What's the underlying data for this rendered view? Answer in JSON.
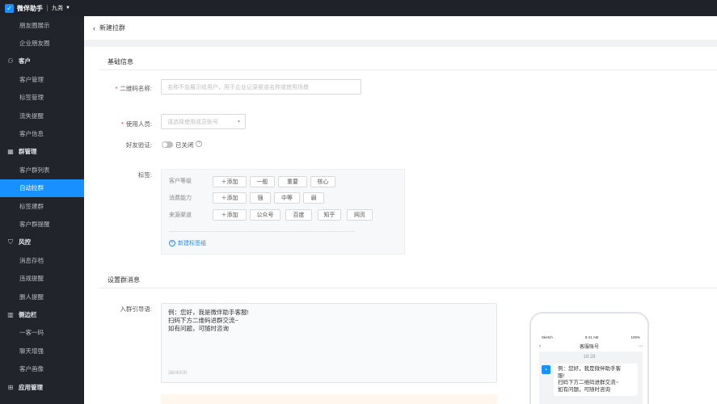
{
  "topbar": {
    "brand": "微伴助手",
    "org": "九尧"
  },
  "sidebar": {
    "items": [
      {
        "type": "item",
        "label": "朋友圈展示",
        "active": false
      },
      {
        "type": "item",
        "label": "企业朋友圈",
        "active": false
      },
      {
        "type": "group",
        "label": "客户",
        "icon": "person-icon",
        "glyph": "⚇"
      },
      {
        "type": "item",
        "label": "客户管理",
        "active": false
      },
      {
        "type": "item",
        "label": "标签管理",
        "active": false
      },
      {
        "type": "item",
        "label": "流失提醒",
        "active": false
      },
      {
        "type": "item",
        "label": "客户信息",
        "active": false
      },
      {
        "type": "group",
        "label": "群管理",
        "icon": "grid-icon",
        "glyph": "▦"
      },
      {
        "type": "item",
        "label": "客户群列表",
        "active": false
      },
      {
        "type": "item",
        "label": "自动拉群",
        "active": true
      },
      {
        "type": "item",
        "label": "标签建群",
        "active": false
      },
      {
        "type": "item",
        "label": "客户群提醒",
        "active": false
      },
      {
        "type": "group",
        "label": "风控",
        "icon": "shield-icon",
        "glyph": "⛉"
      },
      {
        "type": "item",
        "label": "消息存档",
        "active": false
      },
      {
        "type": "item",
        "label": "违规提醒",
        "active": false
      },
      {
        "type": "item",
        "label": "删人提醒",
        "active": false
      },
      {
        "type": "group",
        "label": "侧边栏",
        "icon": "sidebar-icon",
        "glyph": "▥"
      },
      {
        "type": "item",
        "label": "一客一码",
        "active": false
      },
      {
        "type": "item",
        "label": "聊天增强",
        "active": false
      },
      {
        "type": "item",
        "label": "客户画像",
        "active": false
      },
      {
        "type": "group",
        "label": "应用管理",
        "icon": "apps-icon",
        "glyph": "⊞"
      }
    ]
  },
  "header": {
    "title": "新建拉群"
  },
  "basic": {
    "section_title": "基础信息",
    "qrcode_label": "二维码名称:",
    "qrcode_placeholder": "名称不会展示给用户，用于企业记录渠道名称或使用场景",
    "user_label": "使用人员:",
    "user_placeholder": "请选择使用成员账号",
    "verify_label": "好友验证:",
    "verify_value": "已关闭",
    "tags_label": "标签:",
    "tag_groups": [
      {
        "name": "客户等级",
        "tags": [
          "一般",
          "重要",
          "核心"
        ]
      },
      {
        "name": "消费能力",
        "tags": [
          "强",
          "中等",
          "弱"
        ]
      },
      {
        "name": "来源渠道",
        "tags": [
          "公众号",
          "百度",
          "知乎",
          "网页"
        ]
      }
    ],
    "add_label": "添加",
    "new_group_label": "新建标签组"
  },
  "group_msg": {
    "section_title": "设置群消息",
    "guide_label": "入群引导语:",
    "guide_lines": [
      "例：您好，我是微伴助手客服!",
      "扫码下方二维码进群交流~",
      "如有问题，可随时咨询"
    ],
    "counter": "38/4000"
  },
  "phone_preview": {
    "carrier": "Sketch",
    "time": "9:41 AM",
    "battery": "100%",
    "title": "客服账号",
    "chat_time": "18:28",
    "bubble_lines": [
      "例：您好，我是微伴助手客",
      "服!",
      "扫码下方二维码进群交流~",
      "如有问题，可随时咨询"
    ]
  },
  "colors": {
    "accent": "#1890ff",
    "sidebar_bg": "#21252b",
    "topbar_bg": "#1f2329"
  }
}
